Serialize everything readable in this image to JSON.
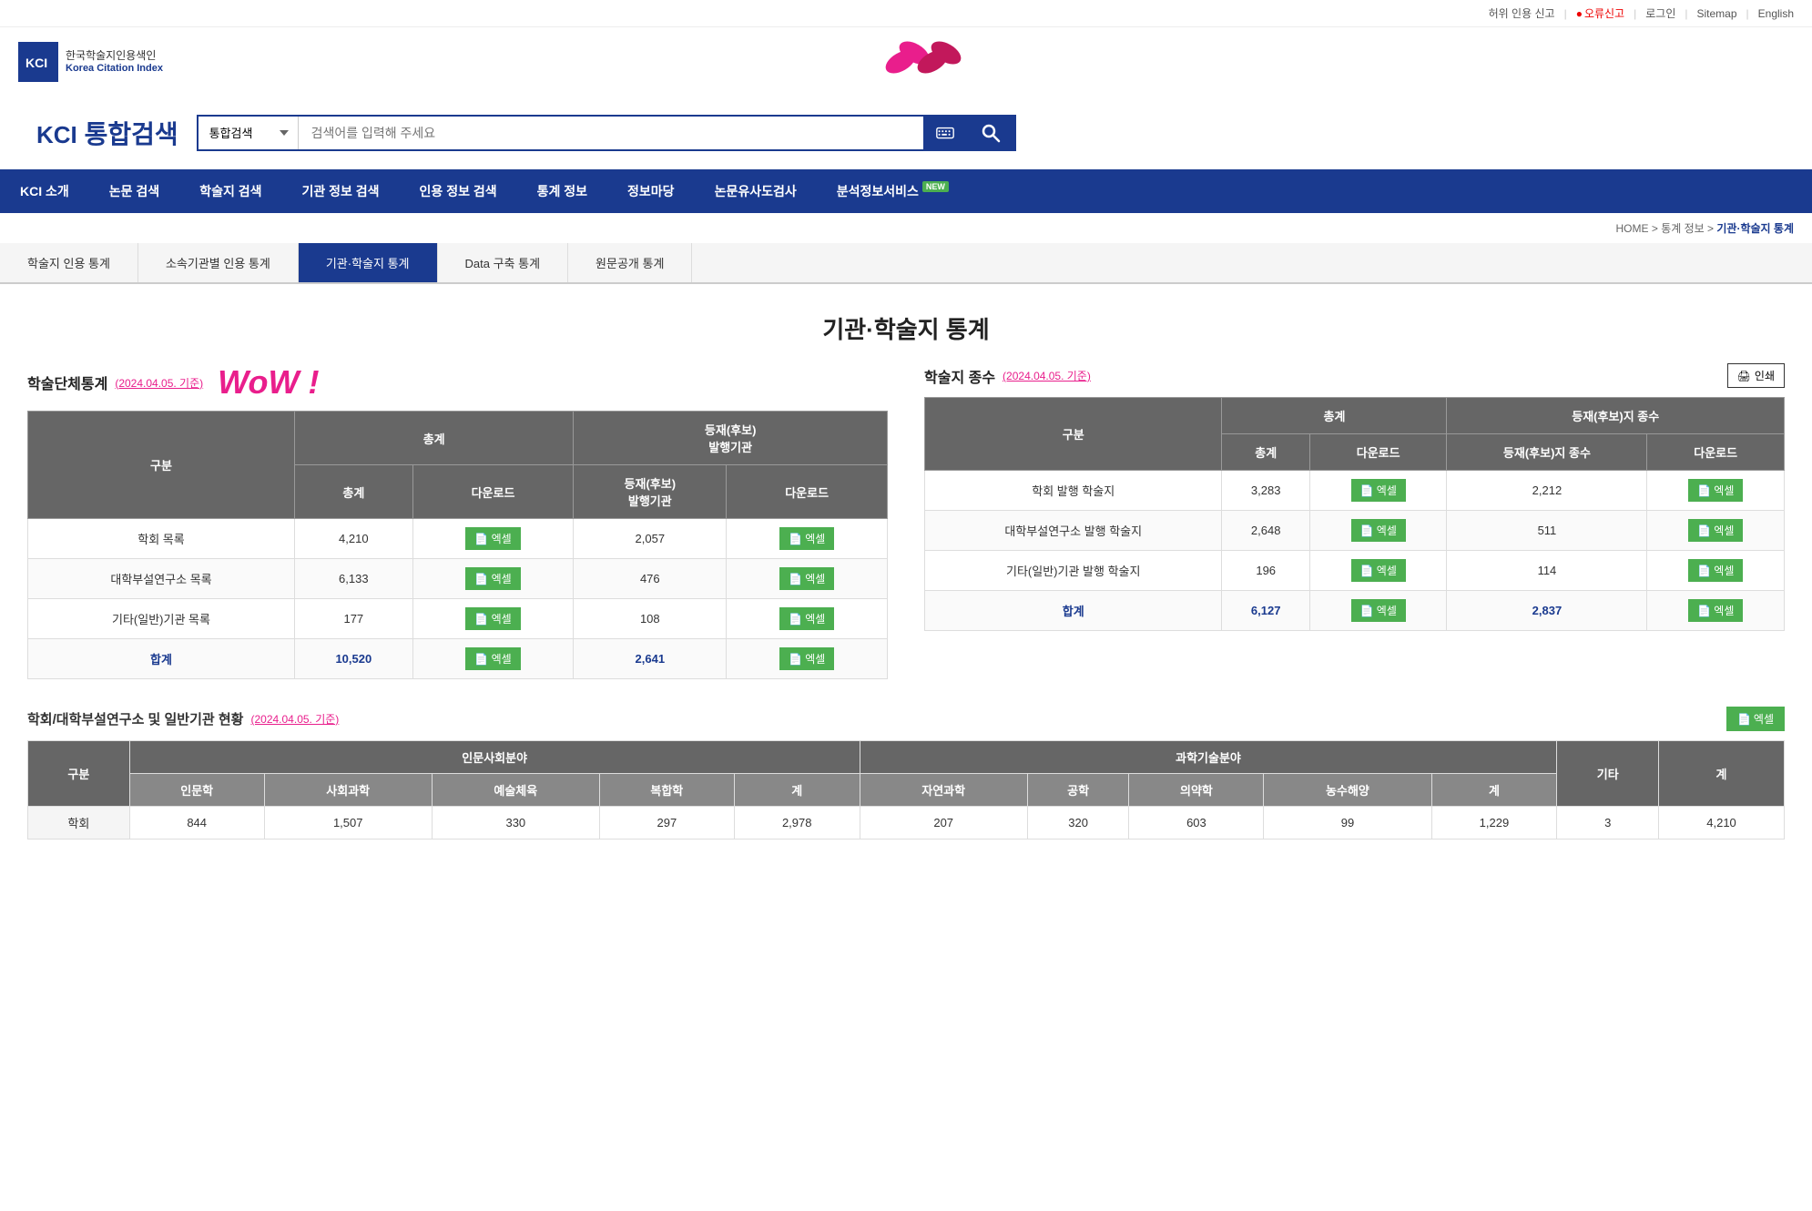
{
  "topbar": {
    "fake_citation": "허위 인용 신고",
    "error_report": "오류신고",
    "login": "로그인",
    "sitemap": "Sitemap",
    "english": "English"
  },
  "logo": {
    "korean": "한국학술지인용색인",
    "english": "Korea Citation Index"
  },
  "search": {
    "title_kci": "KCI",
    "title_main": "통합검색",
    "select_default": "통합검색",
    "placeholder": "검색어를 입력해 주세요"
  },
  "nav": {
    "items": [
      {
        "label": "KCI 소개",
        "new": false
      },
      {
        "label": "논문 검색",
        "new": false
      },
      {
        "label": "학술지 검색",
        "new": false
      },
      {
        "label": "기관 정보 검색",
        "new": false
      },
      {
        "label": "인용 정보 검색",
        "new": false
      },
      {
        "label": "통계 정보",
        "new": false
      },
      {
        "label": "정보마당",
        "new": false
      },
      {
        "label": "논문유사도검사",
        "new": false
      },
      {
        "label": "분석정보서비스",
        "new": true
      }
    ]
  },
  "breadcrumb": {
    "home": "HOME",
    "stats": "통계 정보",
    "current": "기관·학술지 통계"
  },
  "subnav": {
    "items": [
      {
        "label": "학술지 인용 통계",
        "active": false
      },
      {
        "label": "소속기관별 인용 통계",
        "active": false
      },
      {
        "label": "기관·학술지 통계",
        "active": true
      },
      {
        "label": "Data 구축 통계",
        "active": false
      },
      {
        "label": "원문공개 통계",
        "active": false
      }
    ]
  },
  "page_title": "기관·학술지 통계",
  "academic_stats": {
    "title": "학술단체통계",
    "date": "(2024.04.05. 기준)",
    "wow_text": "WoW !",
    "columns": [
      "구분",
      "총계",
      "다운로드",
      "등재(후보)\n발행기관",
      "다운로드"
    ],
    "rows": [
      {
        "label": "학회 목록",
        "total": "4,210",
        "total_dl": "엑셀",
        "registered": "2,057",
        "reg_dl": "엑셀"
      },
      {
        "label": "대학부설연구소 목록",
        "total": "6,133",
        "total_dl": "엑셀",
        "registered": "476",
        "reg_dl": "엑셀"
      },
      {
        "label": "기타(일반)기관 목록",
        "total": "177",
        "total_dl": "엑셀",
        "registered": "108",
        "reg_dl": "엑셀"
      },
      {
        "label": "합계",
        "total": "10,520",
        "total_dl": "엑셀",
        "registered": "2,641",
        "reg_dl": "엑셀",
        "is_total": true
      }
    ]
  },
  "journal_stats": {
    "title": "학술지 종수",
    "date": "(2024.04.05. 기준)",
    "print_label": "인쇄",
    "columns": [
      "구분",
      "총계",
      "다운로드",
      "등재(후보)지 종수",
      "다운로드"
    ],
    "rows": [
      {
        "label": "학회 발행 학술지",
        "total": "3,283",
        "total_dl": "엑셀",
        "registered": "2,212",
        "reg_dl": "엑셀"
      },
      {
        "label": "대학부설연구소 발행 학술지",
        "total": "2,648",
        "total_dl": "엑셀",
        "registered": "511",
        "reg_dl": "엑셀"
      },
      {
        "label": "기타(일반)기관 발행 학술지",
        "total": "196",
        "total_dl": "엑셀",
        "registered": "114",
        "reg_dl": "엑셀"
      },
      {
        "label": "합계",
        "total": "6,127",
        "total_dl": "엑셀",
        "registered": "2,837",
        "reg_dl": "엑셀",
        "is_total": true
      }
    ]
  },
  "institution_stats": {
    "title": "학회/대학부설연구소 및 일반기관 현황",
    "date": "(2024.04.05. 기준)",
    "excel_label": "엑셀",
    "col_groups": [
      "구분",
      "인문사회분야",
      "과학기술분야",
      "기타",
      "계"
    ],
    "sub_cols_humanities": [
      "인문학",
      "사회과학",
      "예술체육",
      "복합학",
      "계"
    ],
    "sub_cols_science": [
      "자연과학",
      "공학",
      "의약학",
      "농수해양",
      "계"
    ],
    "rows": [
      {
        "label": "학회",
        "h1": "844",
        "h2": "1,507",
        "h3": "330",
        "h4": "297",
        "h5": "2,978",
        "s1": "207",
        "s2": "320",
        "s3": "603",
        "s4": "99",
        "s5": "1,229",
        "etc": "3",
        "total": "4,210"
      }
    ]
  }
}
